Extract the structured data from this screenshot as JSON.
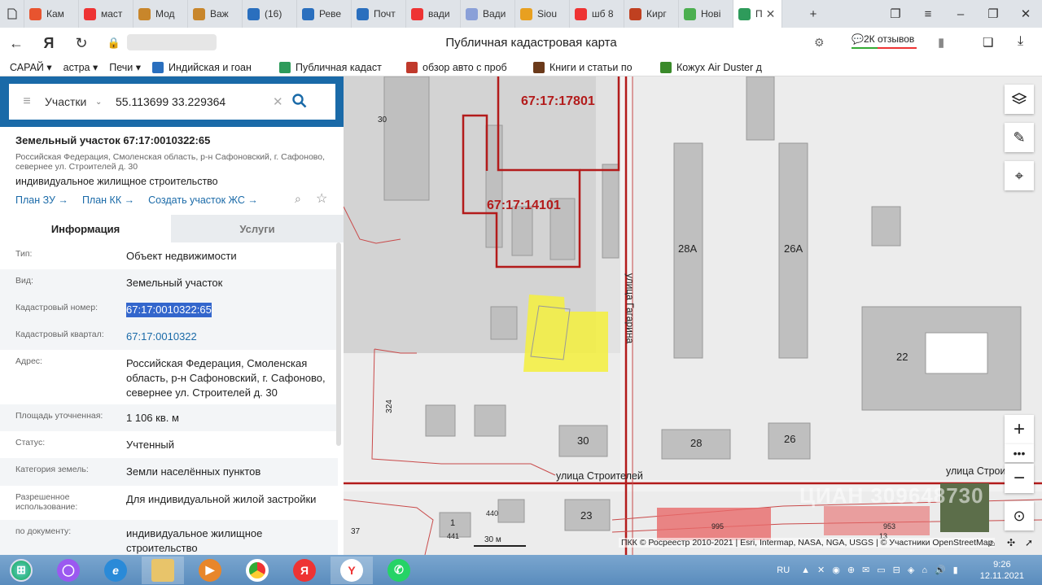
{
  "browser": {
    "tabs": [
      {
        "label": "Кам",
        "color": "#e8542f",
        "icon": "flame-icon"
      },
      {
        "label": "маст",
        "color": "#e33",
        "icon": "yandex-icon"
      },
      {
        "label": "Мод",
        "color": "#c8862b",
        "icon": "circle-icon"
      },
      {
        "label": "Важ",
        "color": "#c8862b",
        "icon": "circle-icon"
      },
      {
        "label": "(16)",
        "color": "#2a6fbe",
        "icon": "vk-icon"
      },
      {
        "label": "Реве",
        "color": "#2a6fbe",
        "icon": "circle-icon"
      },
      {
        "label": "Почт",
        "color": "#2a6fbe",
        "icon": "mail-icon"
      },
      {
        "label": "вади",
        "color": "#e33",
        "icon": "yandex-icon"
      },
      {
        "label": "Вади",
        "color": "#8aa0d8",
        "icon": "circle-icon"
      },
      {
        "label": "Siou",
        "color": "#e8a020",
        "icon": "circle-icon"
      },
      {
        "label": "шб 8",
        "color": "#e33",
        "icon": "yandex-icon"
      },
      {
        "label": "Кирг",
        "color": "#c04020",
        "icon": "bg-icon"
      },
      {
        "label": "Нові",
        "color": "#4caf50",
        "icon": "grid-icon"
      },
      {
        "label": "П",
        "color": "#2e9b5b",
        "icon": "map-icon"
      }
    ],
    "page_title": "Публичная кадастровая карта",
    "reviews": "2К отзывов",
    "bookmarks": [
      {
        "label": "САРАЙ ▾",
        "color": ""
      },
      {
        "label": "астра ▾",
        "color": ""
      },
      {
        "label": "Печи ▾",
        "color": ""
      },
      {
        "label": "Индийская и гоан",
        "color": "#2a6fbe"
      },
      {
        "label": "Публичная кадаст",
        "color": "#2e9b5b"
      },
      {
        "label": "обзор авто с проб",
        "color": "#c0392b"
      },
      {
        "label": "Книги и статьи по",
        "color": "#6b3a1a"
      },
      {
        "label": "Кожух Air Duster д",
        "color": "#3a8a2a"
      }
    ]
  },
  "search": {
    "mode": "Участки",
    "query": "55.113699 33.229364"
  },
  "parcel": {
    "title": "Земельный участок 67:17:0010322:65",
    "address_short": "Российская Федерация, Смоленская область, р-н Сафоновский, г. Сафоново, севернее ул. Строителей д. 30",
    "use": "индивидуальное жилищное строительство",
    "links": [
      "План ЗУ →",
      "План КК →",
      "Создать участок ЖС →"
    ],
    "tabs": [
      "Информация",
      "Услуги"
    ],
    "rows": [
      {
        "label": "Тип:",
        "value": "Объект недвижимости"
      },
      {
        "label": "Вид:",
        "value": "Земельный участок"
      },
      {
        "label": "Кадастровый номер:",
        "value": "67:17:0010322:65"
      },
      {
        "label": "Кадастровый квартал:",
        "value": "67:17:0010322"
      },
      {
        "label": "Адрес:",
        "value": "Российская Федерация, Смоленская область, р-н Сафоновский, г. Сафоново, севернее ул. Строителей д. 30"
      },
      {
        "label": "Площадь уточненная:",
        "value": "1 106 кв. м"
      },
      {
        "label": "Статус:",
        "value": "Учтенный"
      },
      {
        "label": "Категория земель:",
        "value": "Земли населённых пунктов"
      },
      {
        "label": "Разрешенное использование:",
        "value": "Для индивидуальной жилой застройки"
      },
      {
        "label": "по документу:",
        "value": "индивидуальное жилищное строительство"
      }
    ]
  },
  "map": {
    "parcel_labels": [
      "67:17:17801",
      "67:17:14101"
    ],
    "building_numbers": [
      "30",
      "28А",
      "26А",
      "22",
      "324",
      "30",
      "28",
      "26",
      "23",
      "1",
      "441",
      "440",
      "37",
      "995",
      "953",
      "13"
    ],
    "streets": [
      "улица Гагарина",
      "улица Строителей",
      "улица Строи"
    ],
    "scale": "30 м",
    "attribution": "ПКК © Росреестр 2010-2021 | Esri, Intermap, NASA, NGA, USGS | © Участники OpenStreetMap",
    "watermark": "ЦИАН 309648730"
  },
  "taskbar": {
    "lang": "RU",
    "time": "9:26",
    "date": "12.11.2021"
  }
}
